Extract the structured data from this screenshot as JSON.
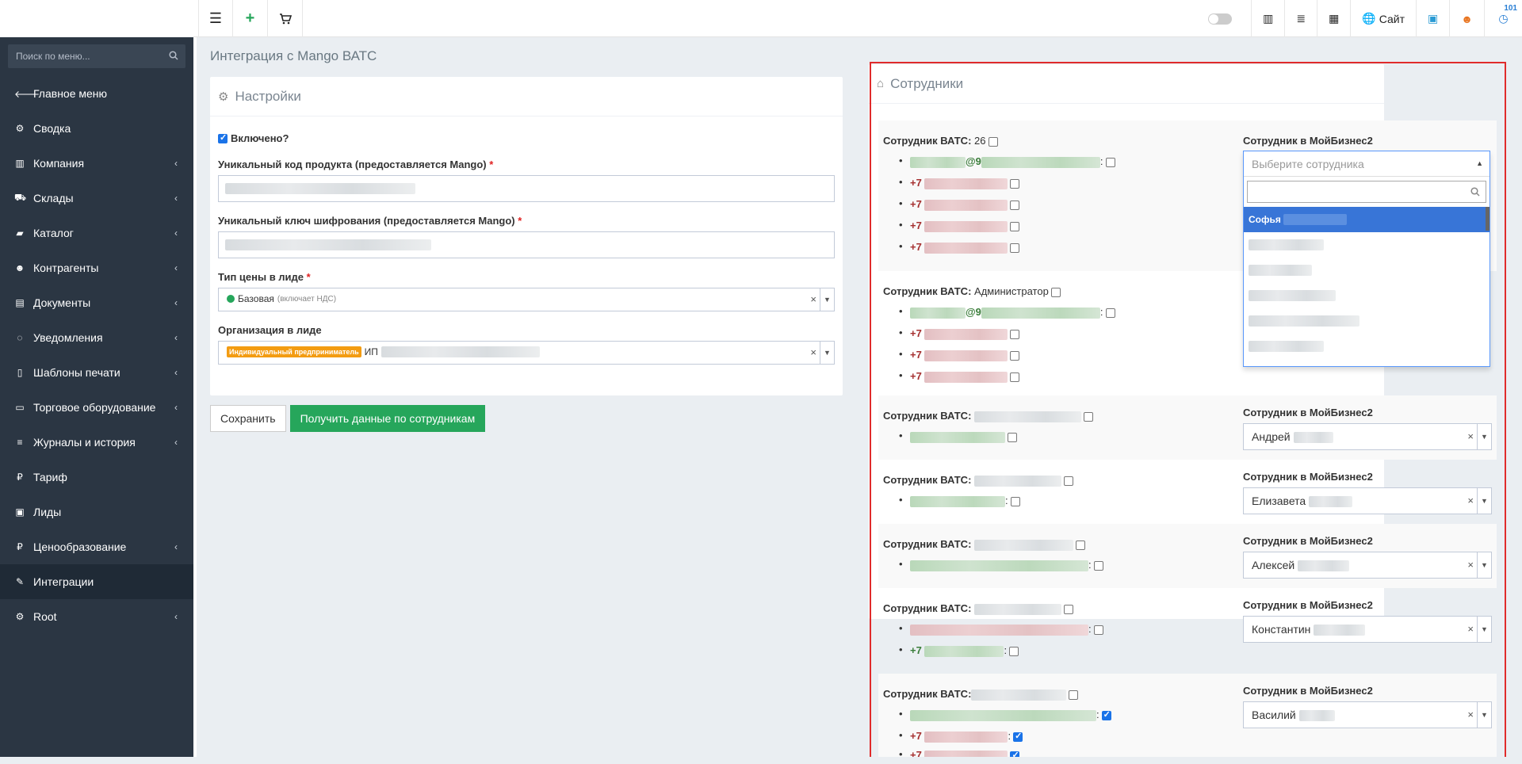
{
  "topbar": {
    "site_label": "Сайт",
    "notif_count": "101"
  },
  "sidebar": {
    "search_placeholder": "Поиск по меню...",
    "items": [
      {
        "label": "Главное меню",
        "icon": "arrow-left-icon",
        "has_chevron": false
      },
      {
        "label": "Сводка",
        "icon": "gear-icon",
        "has_chevron": false
      },
      {
        "label": "Компания",
        "icon": "bar-chart-icon",
        "has_chevron": true
      },
      {
        "label": "Склады",
        "icon": "truck-icon",
        "has_chevron": true
      },
      {
        "label": "Каталог",
        "icon": "folder-icon",
        "has_chevron": true
      },
      {
        "label": "Контрагенты",
        "icon": "users-icon",
        "has_chevron": true
      },
      {
        "label": "Документы",
        "icon": "document-icon",
        "has_chevron": true
      },
      {
        "label": "Уведомления",
        "icon": "comments-icon",
        "has_chevron": true
      },
      {
        "label": "Шаблоны печати",
        "icon": "file-icon",
        "has_chevron": true
      },
      {
        "label": "Торговое оборудование",
        "icon": "inbox-icon",
        "has_chevron": true
      },
      {
        "label": "Журналы и история",
        "icon": "list-icon",
        "has_chevron": true
      },
      {
        "label": "Тариф",
        "icon": "ruble-icon",
        "has_chevron": false
      },
      {
        "label": "Лиды",
        "icon": "contact-icon",
        "has_chevron": false
      },
      {
        "label": "Ценообразование",
        "icon": "ruble-icon",
        "has_chevron": true
      },
      {
        "label": "Интеграции",
        "icon": "paperclip-icon",
        "has_chevron": false,
        "active": true
      },
      {
        "label": "Root",
        "icon": "cogs-icon",
        "has_chevron": true
      }
    ]
  },
  "page": {
    "title": "Интеграция с Mango ВАТС"
  },
  "settings": {
    "header": "Настройки",
    "enabled_label": "Включено?",
    "enabled": true,
    "product_code_label": "Уникальный код продукта (предоставляется Mango)",
    "encryption_key_label": "Уникальный ключ шифрования (предоставляется Mango)",
    "price_type_label": "Тип цены в лиде",
    "price_type_value": "Базовая",
    "price_type_note": "(включает НДС)",
    "org_label": "Организация в лиде",
    "org_badge": "Индивидуальный предприниматель",
    "org_value_prefix": "ИП",
    "clear_symbol": "×",
    "save_btn": "Сохранить",
    "fetch_btn": "Получить данные по сотрудникам"
  },
  "employees": {
    "header": "Сотрудники",
    "vats_label": "Сотрудник ВАТС:",
    "mb_label": "Сотрудник в МойБизнес2",
    "phone_prefix": "+7",
    "email_at": "@9",
    "rows": [
      {
        "vats_name": "26",
        "assigned": "",
        "placeholder": "Выберите сотрудника"
      },
      {
        "vats_name": "Администратор",
        "assigned": ""
      },
      {
        "vats_name": "",
        "assigned": "Андрей"
      },
      {
        "vats_name": "",
        "assigned": "Елизавета"
      },
      {
        "vats_name": "",
        "assigned": "Алексей"
      },
      {
        "vats_name": "",
        "assigned": "Константин"
      },
      {
        "vats_name": "",
        "assigned": "Василий"
      }
    ],
    "dropdown": {
      "placeholder": "Выберите сотрудника",
      "highlighted_option": "Софья"
    }
  },
  "colors": {
    "sidebar_bg": "#2b3643",
    "accent_green": "#26a65b",
    "highlight_blue": "#3875d7",
    "outline_red": "#e02b2b"
  }
}
